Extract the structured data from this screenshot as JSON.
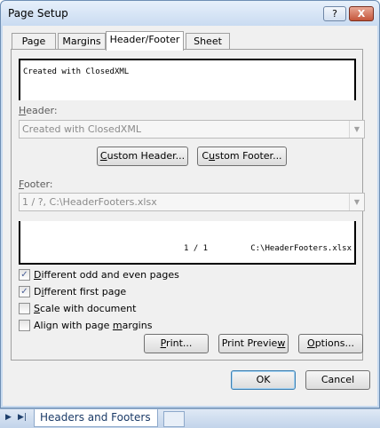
{
  "window": {
    "title": "Page Setup"
  },
  "titlebar": {
    "help": "?",
    "close": "X"
  },
  "tabs": [
    {
      "label": "Page"
    },
    {
      "label": "Margins"
    },
    {
      "label": "Header/Footer"
    },
    {
      "label": "Sheet"
    }
  ],
  "header_preview": {
    "left": "Created with ClosedXML"
  },
  "header": {
    "label": "Header:",
    "value": "Created with ClosedXML"
  },
  "buttons": {
    "custom_header": "Custom Header...",
    "custom_footer": "Custom Footer...",
    "print": "Print...",
    "print_preview": "Print Preview",
    "options": "Options...",
    "ok": "OK",
    "cancel": "Cancel"
  },
  "footer": {
    "label": "Footer:",
    "value": "1 / ?, C:\\HeaderFooters.xlsx"
  },
  "footer_preview": {
    "center": "1 / 1",
    "right": "C:\\HeaderFooters.xlsx"
  },
  "checkboxes": [
    {
      "label": "Different odd and even pages",
      "checked": true
    },
    {
      "label": "Different first page",
      "checked": true
    },
    {
      "label": "Scale with document",
      "checked": false
    },
    {
      "label": "Align with page margins",
      "checked": false
    }
  ],
  "sheetbar": {
    "active_tab": "Headers and Footers"
  }
}
